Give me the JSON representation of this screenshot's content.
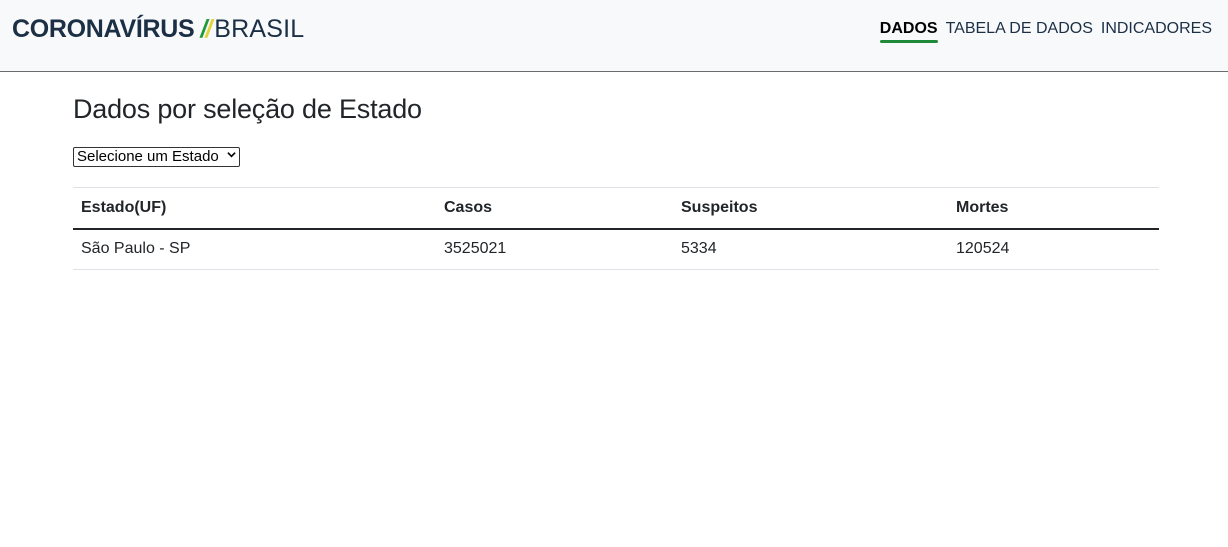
{
  "brand": {
    "bold": "CORONAVÍRUS",
    "slash1": "/",
    "slash2": "/",
    "light": "BRASIL"
  },
  "nav": {
    "items": [
      {
        "label": "DADOS",
        "active": true
      },
      {
        "label": "TABELA DE DADOS",
        "active": false
      },
      {
        "label": "INDICADORES",
        "active": false
      }
    ]
  },
  "main": {
    "title": "Dados por seleção de Estado",
    "select": {
      "selected": "Selecione um Estado"
    },
    "table": {
      "headers": [
        "Estado(UF)",
        "Casos",
        "Suspeitos",
        "Mortes"
      ],
      "rows": [
        [
          "São Paulo - SP",
          "3525021",
          "5334",
          "120524"
        ]
      ]
    }
  }
}
